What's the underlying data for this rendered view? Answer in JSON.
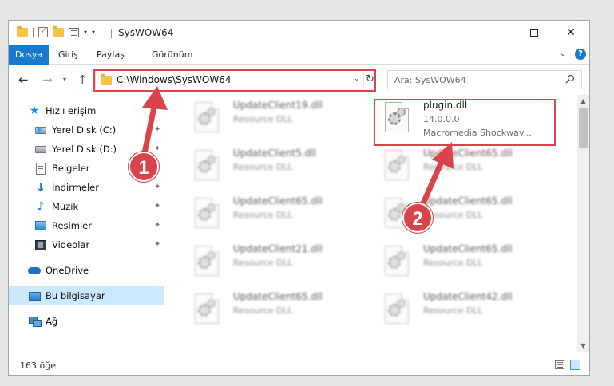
{
  "window": {
    "title": "SysWOW64",
    "controls": {
      "minimize": "—",
      "maximize": "☐",
      "close": "✕"
    }
  },
  "ribbon": {
    "tabs": [
      {
        "label": "Dosya",
        "active": true
      },
      {
        "label": "Giriş"
      },
      {
        "label": "Paylaş"
      },
      {
        "label": "Görünüm"
      }
    ],
    "expand": "⌄",
    "help": "?"
  },
  "nav": {
    "back": "←",
    "forward": "→",
    "recent": "▾",
    "up": "↑",
    "address": "C:\\Windows\\SysWOW64",
    "address_dropdown": "⌄",
    "refresh": "↻",
    "search_placeholder": "Ara: SysWOW64"
  },
  "sidebar": {
    "items": [
      {
        "label": "Hızlı erişim",
        "icon": "star-icon"
      },
      {
        "label": "Yerel Disk (C:)",
        "icon": "disk-icon",
        "pinned": true
      },
      {
        "label": "Yerel Disk (D:)",
        "icon": "disk-icon",
        "pinned": true
      },
      {
        "label": "Belgeler",
        "icon": "document-icon",
        "pinned": true
      },
      {
        "label": "İndirmeler",
        "icon": "download-icon",
        "pinned": true
      },
      {
        "label": "Müzik",
        "icon": "music-icon",
        "pinned": true
      },
      {
        "label": "Resimler",
        "icon": "pictures-icon",
        "pinned": true
      },
      {
        "label": "Videolar",
        "icon": "videos-icon",
        "pinned": true
      },
      {
        "label": "OneDrive",
        "icon": "cloud-icon"
      },
      {
        "label": "Bu bilgisayar",
        "icon": "computer-icon",
        "selected": true
      },
      {
        "label": "Ağ",
        "icon": "network-icon"
      }
    ],
    "pin_glyph": "✦"
  },
  "files": {
    "left_column": [
      {
        "name": "UpdateClient19.dll",
        "desc": "Resource DLL"
      },
      {
        "name": "UpdateClient5.dll",
        "desc": "Resource DLL"
      },
      {
        "name": "UpdateClient65.dll",
        "desc": "Resource DLL"
      },
      {
        "name": "UpdateClient21.dll",
        "desc": "Resource DLL"
      },
      {
        "name": "UpdateClient65.dll",
        "desc": "Resource DLL"
      }
    ],
    "right_column": [
      {
        "name": "plugin.dll",
        "version": "14.0.0.0",
        "desc": "Macromedia Shockwav...",
        "highlighted": true
      },
      {
        "name": "UpdateClient65.dll",
        "desc": "Resource DLL"
      },
      {
        "name": "UpdateClient65.dll",
        "desc": "Resource DLL"
      },
      {
        "name": "UpdateClient65.dll",
        "desc": "Resource DLL"
      },
      {
        "name": "UpdateClient42.dll",
        "desc": "Resource DLL"
      }
    ]
  },
  "status": {
    "item_count": "163 öğe"
  },
  "annotations": {
    "step1": "1",
    "step2": "2",
    "color": "#d9434a"
  }
}
